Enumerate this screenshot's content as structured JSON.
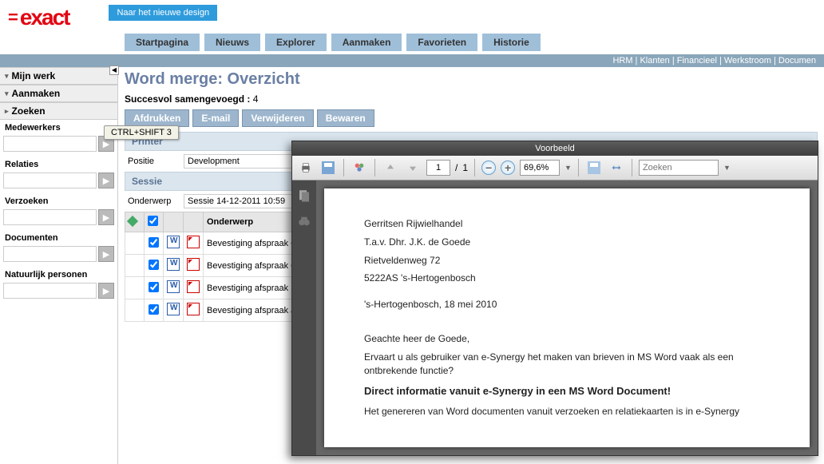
{
  "logo_text": "exact",
  "design_btn": "Naar het nieuwe design",
  "nav": [
    "Startpagina",
    "Nieuws",
    "Explorer",
    "Aanmaken",
    "Favorieten",
    "Historie"
  ],
  "topmenu": "HRM | Klanten | Financieel | Werkstroom | Documen",
  "sidebar": {
    "sections": [
      "Mijn werk",
      "Aanmaken",
      "Zoeken"
    ],
    "fields": [
      "Medewerkers",
      "Relaties",
      "Verzoeken",
      "Documenten",
      "Natuurlijk personen"
    ]
  },
  "tooltip": "CTRL+SHIFT 3",
  "title": "Word merge: Overzicht",
  "status_label": "Succesvol samengevoegd :",
  "status_count": "4",
  "actions": [
    "Afdrukken",
    "E-mail",
    "Verwijderen",
    "Bewaren"
  ],
  "printer_section": "Printer",
  "positie_label": "Positie",
  "positie_value": "Development",
  "sessie_section": "Sessie",
  "onderwerp_label": "Onderwerp",
  "onderwerp_value": "Sessie 14-12-2011 10:59",
  "col_onderwerp": "Onderwerp",
  "rows": [
    "Bevestiging afspraak Gerritsen Rijwielhandel Deursen",
    "Bevestiging afspraak Green, J.-John Green",
    "Bevestiging afspraak Roveba B.V.-Arie Ro",
    "Bevestiging afspraak Jan-Pieter van der W"
  ],
  "preview": {
    "title": "Voorbeeld",
    "page_current": "1",
    "page_total": "1",
    "zoom": "69,6%",
    "search_placeholder": "Zoeken",
    "doc": {
      "line1": "Gerritsen Rijwielhandel",
      "line2": "T.a.v. Dhr. J.K. de Goede",
      "line3": "Rietveldenweg 72",
      "line4": "5222AS 's-Hertogenbosch",
      "date": "'s-Hertogenbosch, 18 mei 2010",
      "greeting": "Geachte heer de Goede,",
      "p1": "Ervaart u als gebruiker van e-Synergy het maken van brieven in MS Word vaak als een ontbrekende functie?",
      "h": "Direct informatie vanuit e-Synergy in een MS Word Document!",
      "p2": "Het genereren van Word documenten vanuit verzoeken en relatiekaarten is in e-Synergy"
    }
  }
}
